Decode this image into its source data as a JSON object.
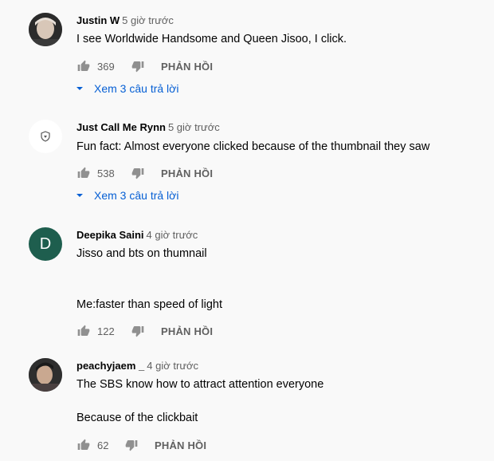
{
  "comments": [
    {
      "author": "Justin W",
      "time": "5 giờ trước",
      "lines": [
        "I see Worldwide Handsome and Queen Jisoo, I click."
      ],
      "likes": "369",
      "reply_label": "PHẢN HỒI",
      "view_replies": "Xem 3 câu trả lời"
    },
    {
      "author": "Just Call Me Rynn",
      "time": "5 giờ trước",
      "lines": [
        "Fun fact: Almost everyone clicked because of the thumbnail they saw"
      ],
      "likes": "538",
      "reply_label": "PHẢN HỒI",
      "view_replies": "Xem 3 câu trả lời"
    },
    {
      "author": "Deepika Saini",
      "time": "4 giờ trước",
      "avatar_letter": "D",
      "lines": [
        "Jisso and bts on thumnail",
        "Me:faster than speed of light"
      ],
      "likes": "122",
      "reply_label": "PHẢN HỒI"
    },
    {
      "author": "peachyjaem _",
      "time": "4 giờ trước",
      "lines": [
        "The SBS know how to attract attention everyone",
        "Because of the clickbait"
      ],
      "likes": "62",
      "reply_label": "PHẢN HỒI"
    }
  ],
  "colors": {
    "background": "#f9f9f9",
    "link_blue": "#065fd4",
    "muted_text": "#606060",
    "avatar_d": "#1e5e4e"
  },
  "icons": [
    "thumb-up-icon",
    "thumb-down-icon",
    "caret-down-icon",
    "shield-icon"
  ]
}
